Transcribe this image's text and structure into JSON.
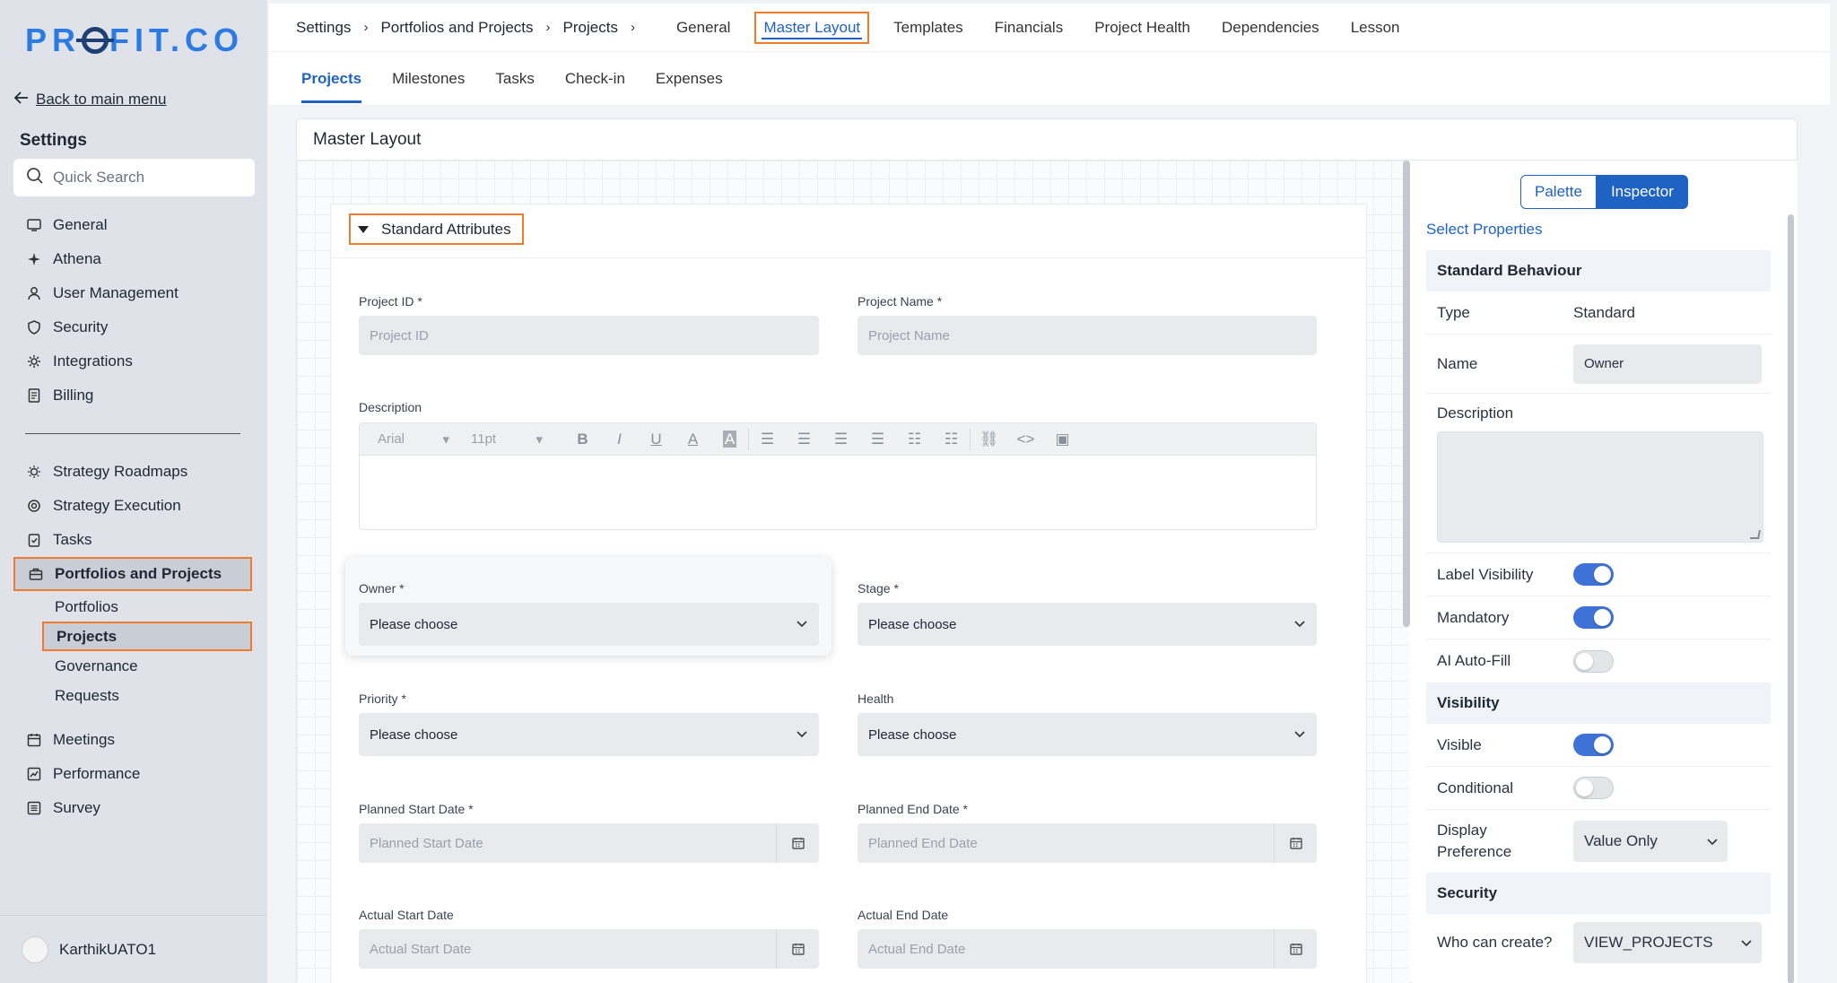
{
  "sidebar": {
    "logo": "PROFIT.CO",
    "back_label": "Back to main menu",
    "settings_title": "Settings",
    "search_placeholder": "Quick Search",
    "group1": [
      "General",
      "Athena",
      "User Management",
      "Security",
      "Integrations",
      "Billing"
    ],
    "group2": [
      "Strategy Roadmaps",
      "Strategy Execution",
      "Tasks",
      "Portfolios and Projects"
    ],
    "portfolios_sub": [
      "Portfolios",
      "Projects",
      "Governance",
      "Requests"
    ],
    "group3": [
      "Meetings",
      "Performance",
      "Survey"
    ],
    "user_name": "KarthikUATO1"
  },
  "breadcrumbs": [
    "Settings",
    "Portfolios and Projects",
    "Projects"
  ],
  "top_tabs": [
    "General",
    "Master Layout",
    "Templates",
    "Financials",
    "Project Health",
    "Dependencies",
    "Lesson"
  ],
  "sub_tabs": [
    "Projects",
    "Milestones",
    "Tasks",
    "Check-in",
    "Expenses"
  ],
  "panel_title": "Master Layout",
  "section_title": "Standard Attributes",
  "form": {
    "project_id_label": "Project ID *",
    "project_id_placeholder": "Project ID",
    "project_name_label": "Project Name *",
    "project_name_placeholder": "Project Name",
    "description_label": "Description",
    "font_family": "Arial",
    "font_size": "11pt",
    "owner_label": "Owner *",
    "stage_label": "Stage *",
    "priority_label": "Priority *",
    "health_label": "Health",
    "choose": "Please choose",
    "planned_start_label": "Planned Start Date *",
    "planned_start_placeholder": "Planned Start Date",
    "planned_end_label": "Planned End Date *",
    "planned_end_placeholder": "Planned End Date",
    "actual_start_label": "Actual Start Date",
    "actual_start_placeholder": "Actual Start Date",
    "actual_end_label": "Actual End Date",
    "actual_end_placeholder": "Actual End Date"
  },
  "inspector": {
    "palette_label": "Palette",
    "inspector_label": "Inspector",
    "select_properties": "Select Properties",
    "standard_behaviour": "Standard Behaviour",
    "type_label": "Type",
    "type_value": "Standard",
    "name_label": "Name",
    "name_value": "Owner",
    "description_label": "Description",
    "label_visibility": "Label Visibility",
    "mandatory": "Mandatory",
    "ai_autofill": "AI Auto-Fill",
    "visibility_section": "Visibility",
    "visible": "Visible",
    "conditional": "Conditional",
    "display_preference_1": "Display",
    "display_preference_2": "Preference",
    "display_value": "Value Only",
    "security_section": "Security",
    "who_can_create": "Who can create?",
    "who_can_create_value": "VIEW_PROJECTS",
    "toggles": {
      "label_visibility": true,
      "mandatory": true,
      "ai_autofill": false,
      "visible": true,
      "conditional": false
    }
  },
  "colors": {
    "accent": "#1e63c4",
    "highlight": "#f07b2c",
    "toggle_on": "#3f72d6"
  }
}
